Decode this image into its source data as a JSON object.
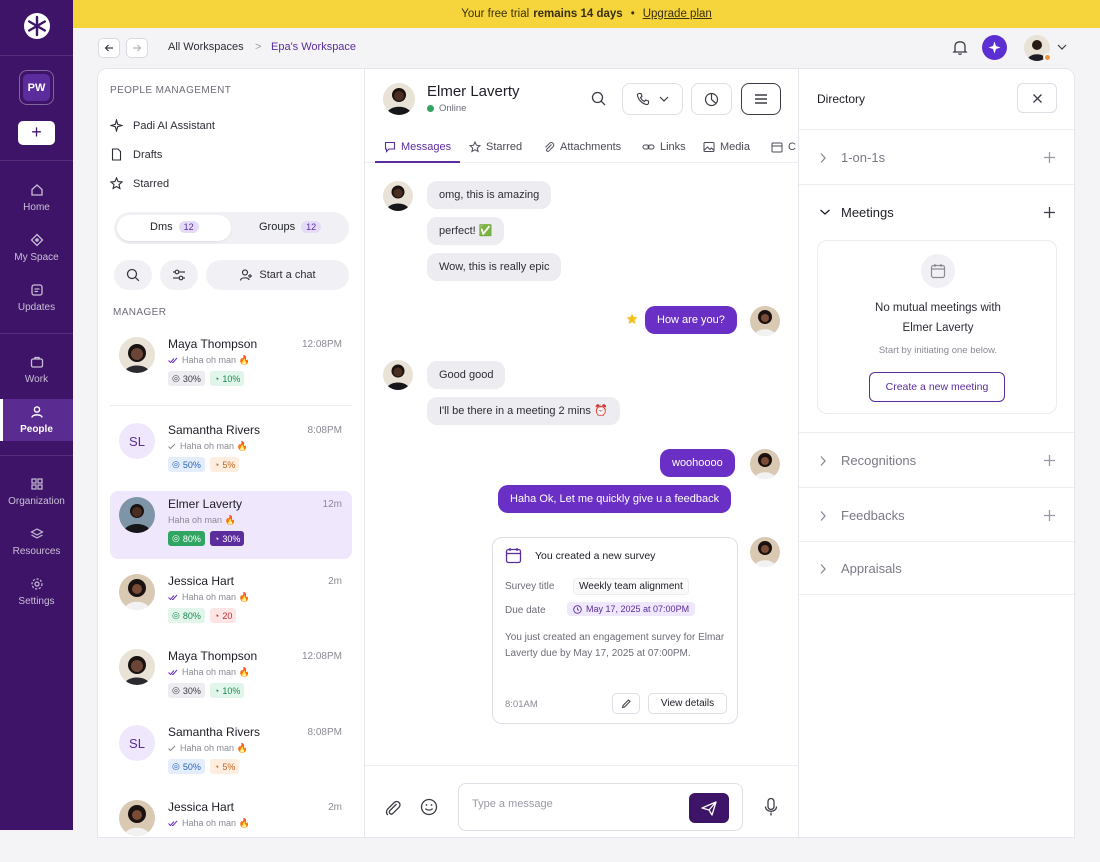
{
  "sidebar": {
    "workspace_initials": "PW",
    "add_label": "+",
    "nav": [
      {
        "label": "Home",
        "icon": "home-icon"
      },
      {
        "label": "My Space",
        "icon": "my-space-icon"
      },
      {
        "label": "Updates",
        "icon": "updates-icon"
      },
      {
        "label": "Work",
        "icon": "briefcase-icon"
      },
      {
        "label": "People",
        "icon": "people-icon",
        "active": true
      },
      {
        "label": "Organization",
        "icon": "grid-icon"
      },
      {
        "label": "Resources",
        "icon": "layers-icon"
      },
      {
        "label": "Settings",
        "icon": "gear-icon"
      }
    ]
  },
  "banner": {
    "prefix": "Your free trial",
    "bold": "remains 14 days",
    "dot": "•",
    "link": "Upgrade plan"
  },
  "breadcrumb": {
    "root": "All Workspaces",
    "separator": ">",
    "current": "Epa's Workspace"
  },
  "list": {
    "section_title": "PEOPLE MANAGEMENT",
    "menu": [
      {
        "label": "Padi AI Assistant",
        "icon": "sparkle-icon"
      },
      {
        "label": "Drafts",
        "icon": "file-icon"
      },
      {
        "label": "Starred",
        "icon": "star-icon"
      }
    ],
    "segments": {
      "dms": {
        "label": "Dms",
        "count": "12"
      },
      "groups": {
        "label": "Groups",
        "count": "12"
      }
    },
    "start_chat": "Start a chat",
    "group_label": "MANAGER",
    "contacts": [
      {
        "name": "Maya Thompson",
        "time": "12:08PM",
        "msg": "Haha oh man 🔥",
        "tags": [
          {
            "text": "30%",
            "style": "t-gray"
          },
          {
            "text": "10%",
            "style": "t-green"
          }
        ]
      },
      {
        "name": "Samantha Rivers",
        "initials": "SL",
        "time": "8:08PM",
        "msg": "Haha oh man 🔥",
        "tags": [
          {
            "text": "50%",
            "style": "t-blue"
          },
          {
            "text": "5%",
            "style": "t-orange"
          }
        ]
      },
      {
        "name": "Elmer Laverty",
        "time": "12m",
        "msg": "Haha oh man 🔥",
        "selected": true,
        "tags": [
          {
            "text": "80%",
            "style": "t-sg"
          },
          {
            "text": "30%",
            "style": "t-sp"
          }
        ]
      },
      {
        "name": "Jessica Hart",
        "time": "2m",
        "msg": "Haha oh man 🔥",
        "tags": [
          {
            "text": "80%",
            "style": "t-green"
          },
          {
            "text": "20",
            "style": "t-red"
          }
        ]
      },
      {
        "name": "Maya Thompson",
        "time": "12:08PM",
        "msg": "Haha oh man 🔥",
        "tags": [
          {
            "text": "30%",
            "style": "t-gray"
          },
          {
            "text": "10%",
            "style": "t-green"
          }
        ]
      },
      {
        "name": "Samantha Rivers",
        "initials": "SL",
        "time": "8:08PM",
        "msg": "Haha oh man 🔥",
        "tags": [
          {
            "text": "50%",
            "style": "t-blue"
          },
          {
            "text": "5%",
            "style": "t-orange"
          }
        ]
      },
      {
        "name": "Jessica Hart",
        "time": "2m",
        "msg": "Haha oh man 🔥",
        "tags": []
      }
    ]
  },
  "chat": {
    "name": "Elmer Laverty",
    "status": "Online",
    "tabs": [
      "Messages",
      "Starred",
      "Attachments",
      "Links",
      "Media",
      "C"
    ],
    "messages": {
      "m1": "omg, this is amazing",
      "m2": "perfect! ✅",
      "m3": "Wow, this is really epic",
      "m4": "How are you?",
      "m5": "Good good",
      "m6": "I'll be there in a meeting 2 mins ⏰",
      "m7": "woohoooo",
      "m8": "Haha Ok, Let me quickly give u a feedback"
    },
    "survey": {
      "title": "You created a new survey",
      "title_key": "Survey title",
      "title_value": "Weekly team alignment",
      "due_key": "Due date",
      "due_value": "May 17, 2025 at 07:00PM",
      "description": "You just created an engagement survey for Elmar Laverty due by May 17, 2025 at 07:00PM.",
      "time": "8:01AM",
      "view_details": "View details"
    },
    "composer_placeholder": "Type a message"
  },
  "directory": {
    "title": "Directory",
    "sections": [
      "1-on-1s",
      "Meetings",
      "Recognitions",
      "Feedbacks",
      "Appraisals"
    ],
    "meetings_empty_line1": "No mutual meetings with",
    "meetings_empty_line2": "Elmer Laverty",
    "meetings_empty_hint": "Start by initiating one below.",
    "create_meeting": "Create a new meeting"
  },
  "colors": {
    "brand": "#3d1468",
    "accent": "#6a2fc4",
    "banner": "#f6d43b"
  }
}
